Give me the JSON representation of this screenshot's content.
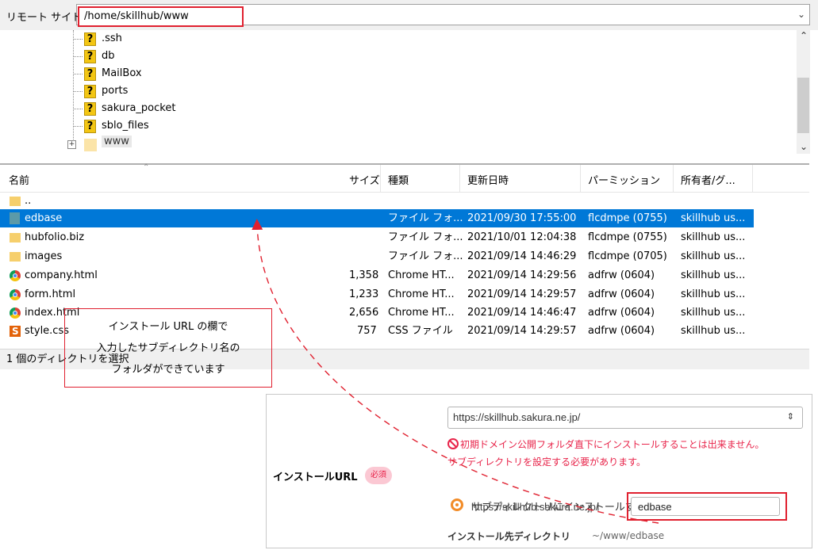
{
  "remote": {
    "label": "リモート サイト:",
    "path": "/home/skillhub/www"
  },
  "tree": {
    "items": [
      {
        "name": ".ssh"
      },
      {
        "name": "db"
      },
      {
        "name": "MailBox"
      },
      {
        "name": "ports"
      },
      {
        "name": "sakura_pocket"
      },
      {
        "name": "sblo_files"
      }
    ],
    "selected": "www"
  },
  "file_list": {
    "columns": [
      "名前",
      "サイズ",
      "種類",
      "更新日時",
      "パーミッション",
      "所有者/グ..."
    ],
    "rows": [
      {
        "name": "..",
        "size": "",
        "type": "",
        "modified": "",
        "perm": "",
        "owner": "",
        "icon": "folder-icon"
      },
      {
        "name": "edbase",
        "size": "",
        "type": "ファイル フォ...",
        "modified": "2021/09/30 17:55:00",
        "perm": "flcdmpe (0755)",
        "owner": "skillhub us...",
        "icon": "folder-icon"
      },
      {
        "name": "hubfolio.biz",
        "size": "",
        "type": "ファイル フォ...",
        "modified": "2021/10/01 12:04:38",
        "perm": "flcdmpe (0755)",
        "owner": "skillhub us...",
        "icon": "folder-icon"
      },
      {
        "name": "images",
        "size": "",
        "type": "ファイル フォ...",
        "modified": "2021/09/14 14:46:29",
        "perm": "flcdmpe (0705)",
        "owner": "skillhub us...",
        "icon": "folder-icon"
      },
      {
        "name": "company.html",
        "size": "1,358",
        "type": "Chrome HT...",
        "modified": "2021/09/14 14:29:56",
        "perm": "adfrw (0604)",
        "owner": "skillhub us...",
        "icon": "chrome-icon"
      },
      {
        "name": "form.html",
        "size": "1,233",
        "type": "Chrome HT...",
        "modified": "2021/09/14 14:29:57",
        "perm": "adfrw (0604)",
        "owner": "skillhub us...",
        "icon": "chrome-icon"
      },
      {
        "name": "index.html",
        "size": "2,656",
        "type": "Chrome HT...",
        "modified": "2021/09/14 14:46:47",
        "perm": "adfrw (0604)",
        "owner": "skillhub us...",
        "icon": "chrome-icon"
      },
      {
        "name": "style.css",
        "size": "757",
        "type": "CSS ファイル",
        "modified": "2021/09/14 14:29:57",
        "perm": "adfrw (0604)",
        "owner": "skillhub us...",
        "icon": "css-file-icon"
      }
    ],
    "status": "1 個のディレクトリを選択"
  },
  "callout": {
    "line1": "インストール URL の欄で",
    "line2": "入力したサブディレクトリ名の",
    "line3": "フォルダができています"
  },
  "install": {
    "url_label": "インストールURL",
    "required": "必須",
    "domain_selected": "https://skillhub.sakura.ne.jp/",
    "warning1": "初期ドメイン公開フォルダ直下にインストールすることは出来ません。",
    "warning2": "サブディレクトリを設定する必要があります。",
    "radio_label": "サブディレクトリにインストールする",
    "prefix": "https://skillhub.sakura.ne.jp/",
    "subdir": "edbase",
    "target_label": "インストール先ディレクトリ",
    "target_value": "~/www/edbase"
  },
  "colors": {
    "highlight": "#e0202f",
    "selection": "#0078d7",
    "warning": "#e8244a",
    "radio": "#f28c28"
  }
}
